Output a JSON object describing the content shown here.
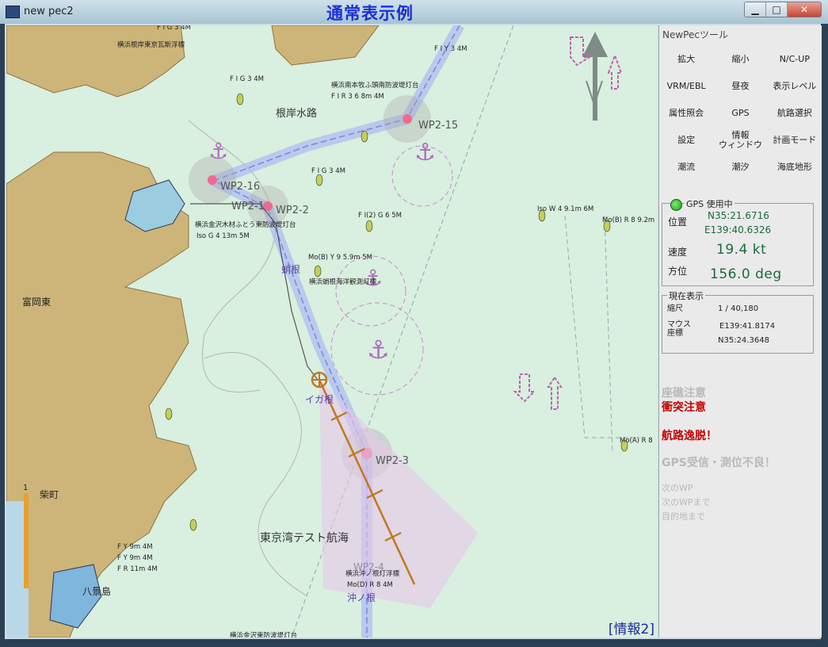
{
  "window": {
    "title": "new pec2",
    "banner": "通常表示例",
    "min": "▁",
    "max": "□",
    "close": "✕"
  },
  "panel": {
    "title": "NewPecツール",
    "tools": [
      "拡大",
      "縮小",
      "N/C-UP",
      "VRM/EBL",
      "昼夜",
      "表示レベル",
      "属性照会",
      "GPS",
      "航路選択",
      "設定",
      "情報\nウィンドウ",
      "計画モード",
      "潮流",
      "潮汐",
      "海底地形"
    ]
  },
  "gps": {
    "title": "GPS 使用中",
    "position_label": "位置",
    "lat": "N35:21.6716",
    "lon": "E139:40.6326",
    "speed_label": "速度",
    "speed": "19.4 kt",
    "heading_label": "方位",
    "heading": "156.0 deg"
  },
  "current": {
    "title": "現在表示",
    "scale_label": "縮尺",
    "scale": "1 / 40,180",
    "mouse_label": "マウス\n座標",
    "mouse_lon": "E139:41.8174",
    "mouse_lat": "N35:24.3648"
  },
  "alerts": {
    "reef": "座礁注意",
    "collision": "衝突注意",
    "offroute": "航路逸脱！",
    "gpsfail": "GPS受信・測位不良！",
    "next_wp": "次のWP",
    "to_next_wp": "次のWPまで",
    "to_destination": "目的地まで"
  },
  "colors": {
    "alert_red": "#c40000",
    "alert_gray": "#b9b9b9",
    "gps_value": "#1a6a3a",
    "route": "#c07820",
    "banner": "#1a2fd6"
  },
  "map": {
    "info_label": "[情報2]",
    "waypoints": [
      "WP2-15",
      "WP2-16",
      "WP2-1",
      "WP2-2",
      "WP2-3",
      "WP2-4"
    ],
    "place_labels": [
      "根岸水路",
      "富岡東",
      "柴町",
      "八景島",
      "東京湾テスト航海",
      "蛸根",
      "イガ根",
      "沖ノ根"
    ],
    "light_labels": [
      "横浜根岸東京瓦斯浮標",
      "F I G 3 4M",
      "F I Y 3 4M",
      "F I G 3 4M",
      "横浜南本牧ふ頭南防波堤灯台",
      "F I R 3 6 8m 4M",
      "F I G 3 4M",
      "横浜金沢木材ふとう東防波堤灯台",
      "Iso G 4 13m 5M",
      "F I(2) G 6 5M",
      "Mo(B) Y 9 5.9m 5M",
      "横浜蛸根海洋観測灯標",
      "Iso W 4 9.1m 6M",
      "Mo(B) R 8 9.2m",
      "Mo(A) R 8",
      "F Y 9m 4M",
      "F Y 9m 4M",
      "F R 11m 4M",
      "横浜沖ノ根灯浮標",
      "Mo(D) R 8 4M",
      "横浜金沢東防波堤灯台"
    ]
  }
}
